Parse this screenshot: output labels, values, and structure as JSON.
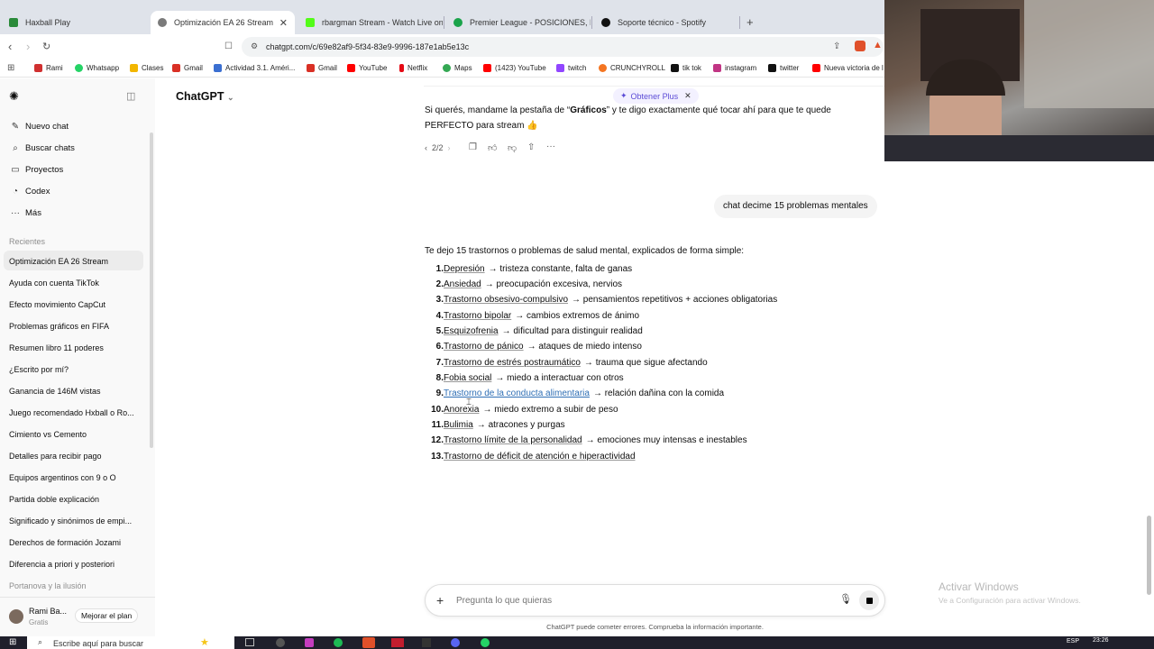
{
  "browser": {
    "tabs": [
      {
        "title": "Haxball Play",
        "color": "#2a8a3a"
      },
      {
        "title": "Optimización EA 26 Stream",
        "color": "#7a7a7a",
        "active": true
      },
      {
        "title": "rbargman Stream - Watch Live on Ki",
        "color": "#53fc18"
      },
      {
        "title": "Premier League - POSICIONES, RESU",
        "color": "#1aa34a"
      },
      {
        "title": "Soporte técnico - Spotify",
        "color": "#111111"
      }
    ],
    "new_tab": "+",
    "url": "chatgpt.com/c/69e82af9-5f34-83e9-9996-187e1ab5e13c",
    "bookmarks": [
      {
        "label": "Rami",
        "color": "#d03030"
      },
      {
        "label": "Whatsapp",
        "color": "#25d366"
      },
      {
        "label": "Clases",
        "color": "#f2b600"
      },
      {
        "label": "Gmail",
        "color": "#d93025"
      },
      {
        "label": "Actividad 3.1. Améri...",
        "color": "#3b6fd1"
      },
      {
        "label": "Gmail",
        "color": "#d93025"
      },
      {
        "label": "YouTube",
        "color": "#ff0000"
      },
      {
        "label": "Netflix",
        "color": "#e50914"
      },
      {
        "label": "Maps",
        "color": "#34a853"
      },
      {
        "label": "(1423) YouTube",
        "color": "#ff0000"
      },
      {
        "label": "twitch",
        "color": "#9146ff"
      },
      {
        "label": "CRUNCHYROLL",
        "color": "#f47521"
      },
      {
        "label": "tik tok",
        "color": "#111111"
      },
      {
        "label": "instagram",
        "color": "#c13584"
      },
      {
        "label": "twitter",
        "color": "#111111"
      },
      {
        "label": "Nueva victoria de l",
        "color": "#ff0000"
      }
    ]
  },
  "sidebar": {
    "nav": [
      {
        "label": "Nuevo chat",
        "icon": "✎"
      },
      {
        "label": "Buscar chats",
        "icon": "⌕"
      },
      {
        "label": "Proyectos",
        "icon": "▭"
      },
      {
        "label": "Codex",
        "icon": "◔"
      },
      {
        "label": "Más",
        "icon": "···"
      }
    ],
    "recent_header": "Recientes",
    "recents": [
      "Optimización EA 26 Stream",
      "Ayuda con cuenta TikTok",
      "Efecto movimiento CapCut",
      "Problemas gráficos en FIFA",
      "Resumen libro 11 poderes",
      "¿Escrito por mí?",
      "Ganancia de 146M vistas",
      "Juego recomendado Hxball o Ro...",
      "Cimiento vs Cemento",
      "Detalles para recibir pago",
      "Equipos argentinos con 9 o O",
      "Partida doble explicación",
      "Significado y sinónimos de empi...",
      "Derechos de formación Jozami",
      "Diferencia a priori y posteriori",
      "Portanova y la ilusión"
    ],
    "user_name": "Rami Ba...",
    "user_plan": "Gratis",
    "upgrade": "Mejorar el plan"
  },
  "header": {
    "model": "ChatGPT",
    "plus_pill": "Obtener Plus"
  },
  "conversation": {
    "prev_line1_pre": "Si querés, mandame la pestaña de “",
    "prev_line1_bold": "Gráficos",
    "prev_line1_post": "” y te digo exactamente qué tocar ahí para que te quede",
    "prev_line2": "PERFECTO para stream 👍",
    "pager": "2/2",
    "user_message": "chat decime 15 problemas mentales",
    "intro": "Te dejo 15 trastornos o problemas de salud mental, explicados de forma simple:",
    "items": [
      {
        "num": "1.",
        "term": "Depresión",
        "desc": "→ tristeza constante, falta de ganas"
      },
      {
        "num": "2.",
        "term": "Ansiedad",
        "desc": "→ preocupación excesiva, nervios"
      },
      {
        "num": "3.",
        "term": "Trastorno obsesivo-compulsivo",
        "desc": "→ pensamientos repetitivos + acciones obligatorias"
      },
      {
        "num": "4.",
        "term": "Trastorno bipolar",
        "desc": "→ cambios extremos de ánimo"
      },
      {
        "num": "5.",
        "term": "Esquizofrenia",
        "desc": "→ dificultad para distinguir realidad"
      },
      {
        "num": "6.",
        "term": "Trastorno de pánico",
        "desc": "→ ataques de miedo intenso"
      },
      {
        "num": "7.",
        "term": "Trastorno de estrés postraumático",
        "desc": "→ trauma que sigue afectando"
      },
      {
        "num": "8.",
        "term": "Fobia social",
        "desc": "→ miedo a interactuar con otros"
      },
      {
        "num": "9.",
        "term": "Trastorno de la conducta alimentaria",
        "desc": "→ relación dañina con la comida"
      },
      {
        "num": "10.",
        "term": "Anorexia",
        "desc": "→ miedo extremo a subir de peso"
      },
      {
        "num": "11.",
        "term": "Bulimia",
        "desc": "→ atracones y purgas"
      },
      {
        "num": "12.",
        "term": "Trastorno límite de la personalidad",
        "desc": "→ emociones muy intensas e inestables"
      },
      {
        "num": "13.",
        "term": "Trastorno de déficit de atención e hiperactividad",
        "desc": ""
      }
    ]
  },
  "composer": {
    "placeholder": "Pregunta lo que quieras",
    "disclaimer": "ChatGPT puede cometer errores. Comprueba la información importante."
  },
  "watermark": {
    "title": "Activar Windows",
    "subtitle": "Ve a Configuración para activar Windows."
  },
  "taskbar": {
    "search": "Escribe aquí para buscar",
    "lang": "ESP",
    "time": "23:26"
  },
  "colors": {
    "link": "#2f6fb5",
    "accent_plus": "#5b4bd6"
  }
}
